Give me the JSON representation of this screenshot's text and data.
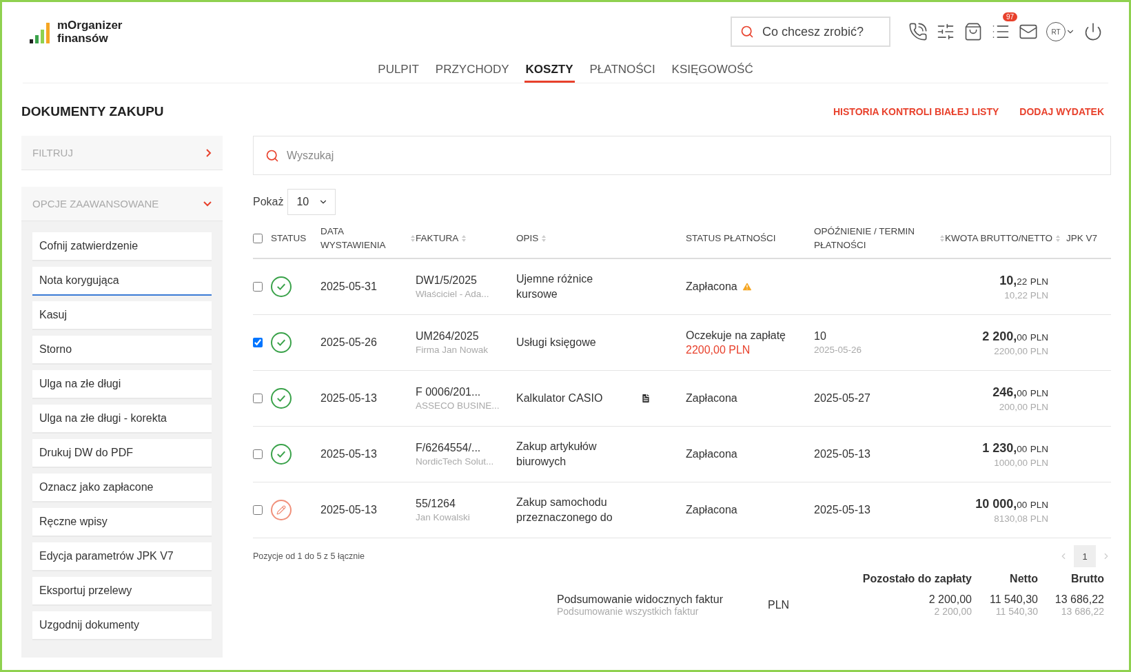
{
  "logo": {
    "line1": "mOrganizer",
    "line2": "finansów"
  },
  "search": {
    "placeholder": "Co chcesz zrobić?"
  },
  "notifications": {
    "badge": "97"
  },
  "user": {
    "initials": "RT"
  },
  "nav": [
    {
      "label": "PULPIT",
      "selected": false
    },
    {
      "label": "PRZYCHODY",
      "selected": false
    },
    {
      "label": "KOSZTY",
      "selected": true
    },
    {
      "label": "PŁATNOŚCI",
      "selected": false
    },
    {
      "label": "KSIĘGOWOŚĆ",
      "selected": false
    }
  ],
  "page_title": "DOKUMENTY ZAKUPU",
  "actions": [
    "HISTORIA KONTROLI BIAŁEJ LISTY",
    "DODAJ WYDATEK"
  ],
  "sidebar": {
    "filter": {
      "label": "FILTRUJ",
      "expanded": false
    },
    "advanced": {
      "label": "OPCJE ZAAWANSOWANE",
      "expanded": true
    },
    "options": [
      {
        "label": "Cofnij zatwierdzenie",
        "selected": false
      },
      {
        "label": "Nota korygująca",
        "selected": true
      },
      {
        "label": "Kasuj",
        "selected": false
      },
      {
        "label": "Storno",
        "selected": false
      },
      {
        "label": "Ulga na złe długi",
        "selected": false
      },
      {
        "label": "Ulga na złe długi - korekta",
        "selected": false
      },
      {
        "label": "Drukuj DW do PDF",
        "selected": false
      },
      {
        "label": "Oznacz jako zapłacone",
        "selected": false
      },
      {
        "label": "Ręczne wpisy",
        "selected": false
      },
      {
        "label": "Edycja parametrów JPK V7",
        "selected": false
      },
      {
        "label": "Eksportuj przelewy",
        "selected": false
      },
      {
        "label": "Uzgodnij dokumenty",
        "selected": false
      }
    ]
  },
  "table_search": {
    "placeholder": "Wyszukaj"
  },
  "page_size": {
    "label": "Pokaż",
    "value": "10"
  },
  "table": {
    "select_all": {
      "checked": false
    },
    "columns": [
      {
        "label": "STATUS",
        "sortable": false
      },
      {
        "label": "DATA WYSTAWIENIA",
        "sortable": true
      },
      {
        "label": "FAKTURA",
        "sortable": true
      },
      {
        "label": "OPIS",
        "sortable": true
      },
      {
        "label": "STATUS PŁATNOŚCI",
        "sortable": false
      },
      {
        "label": "OPÓŹNIENIE / TERMIN PŁATNOŚCI",
        "sortable": true
      },
      {
        "label": "KWOTA BRUTTO/NETTO",
        "sortable": true
      },
      {
        "label": "JPK V7",
        "sortable": false
      }
    ],
    "rows": [
      {
        "checked": false,
        "kind": "approved",
        "date": "2025-05-31",
        "invoice": "DW1/5/2025",
        "party": "Właściciel - Ada...",
        "description": "Ujemne różnice kursowe",
        "attachment": false,
        "payment_status": "Zapłacona",
        "warning": true,
        "gross_int": "10,",
        "gross_dec": "22",
        "currency": "PLN",
        "net": "10,22 PLN"
      },
      {
        "checked": true,
        "kind": "approved",
        "date": "2025-05-26",
        "invoice": "UM264/2025",
        "party": "Firma Jan Nowak",
        "description": "Usługi księgowe",
        "attachment": false,
        "payment_status": "Oczekuje na zapłatę",
        "warning": false,
        "amount_due": "2200,00 PLN",
        "delay": "10",
        "due_date": "2025-05-26",
        "gross_int": "2 200,",
        "gross_dec": "00",
        "currency": "PLN",
        "net": "2200,00 PLN"
      },
      {
        "checked": false,
        "kind": "approved",
        "date": "2025-05-13",
        "invoice": "F 0006/201...",
        "party": "ASSECO BUSINE...",
        "description": "Kalkulator CASIO",
        "attachment": true,
        "payment_status": "Zapłacona",
        "warning": false,
        "delay": "2025-05-27",
        "gross_int": "246,",
        "gross_dec": "00",
        "currency": "PLN",
        "net": "200,00 PLN"
      },
      {
        "checked": false,
        "kind": "approved",
        "date": "2025-05-13",
        "invoice": "F/6264554/...",
        "party": "NordicTech Solut...",
        "description": "Zakup artykułów biurowych",
        "attachment": false,
        "payment_status": "Zapłacona",
        "warning": false,
        "delay": "2025-05-13",
        "gross_int": "1 230,",
        "gross_dec": "00",
        "currency": "PLN",
        "net": "1000,00 PLN"
      },
      {
        "checked": false,
        "kind": "draft",
        "date": "2025-05-13",
        "invoice": "55/1264",
        "party": "Jan Kowalski",
        "description": "Zakup samochodu przeznaczonego do",
        "attachment": false,
        "payment_status": "Zapłacona",
        "warning": false,
        "delay": "2025-05-13",
        "gross_int": "10 000,",
        "gross_dec": "00",
        "currency": "PLN",
        "net": "8130,08 PLN"
      }
    ]
  },
  "pagination": {
    "info": "Pozycje od 1 do 5 z 5 łącznie",
    "pages": [
      {
        "label": "1",
        "selected": true
      }
    ]
  },
  "summary": {
    "headers": [
      "Pozostało do zapłaty",
      "Netto",
      "Brutto"
    ],
    "visible_label": "Podsumowanie widocznych faktur",
    "all_label": "Podsumowanie wszystkich faktur",
    "currency": "PLN",
    "visible": [
      "2 200,00",
      "11 540,30",
      "13 686,22"
    ],
    "all": [
      "2 200,00",
      "11 540,30",
      "13 686,22"
    ]
  }
}
